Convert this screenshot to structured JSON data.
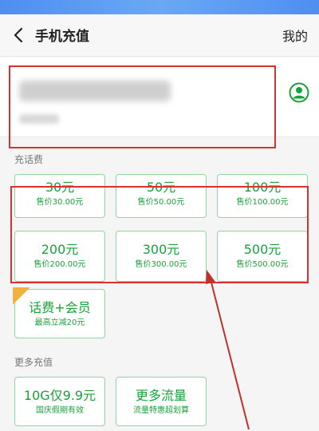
{
  "header": {
    "title": "手机充值",
    "my_label": "我的"
  },
  "sections": {
    "topup_label": "充话费",
    "more_label": "更多充值"
  },
  "topup_cards": [
    {
      "amount": "30元",
      "price": "售价30.00元"
    },
    {
      "amount": "50元",
      "price": "售价50.00元"
    },
    {
      "amount": "100元",
      "price": "售价100.00元"
    },
    {
      "amount": "200元",
      "price": "售价200.00元"
    },
    {
      "amount": "300元",
      "price": "售价300.00元"
    },
    {
      "amount": "500元",
      "price": "售价500.00元"
    }
  ],
  "member_card": {
    "title": "话费+会员",
    "sub": "最高立减20元"
  },
  "more_cards": [
    {
      "title": "10G仅9.9元",
      "sub": "国庆假期有效"
    },
    {
      "title": "更多流量",
      "sub": "流量特惠超划算"
    }
  ],
  "colors": {
    "accent_green": "#18a33a",
    "card_border": "#8fd69f",
    "highlight_red": "#d9312e",
    "status_bar_blue": "#4f8ef0"
  },
  "icons": {
    "back": "chevron-left-icon",
    "contact": "contact-person-icon"
  }
}
